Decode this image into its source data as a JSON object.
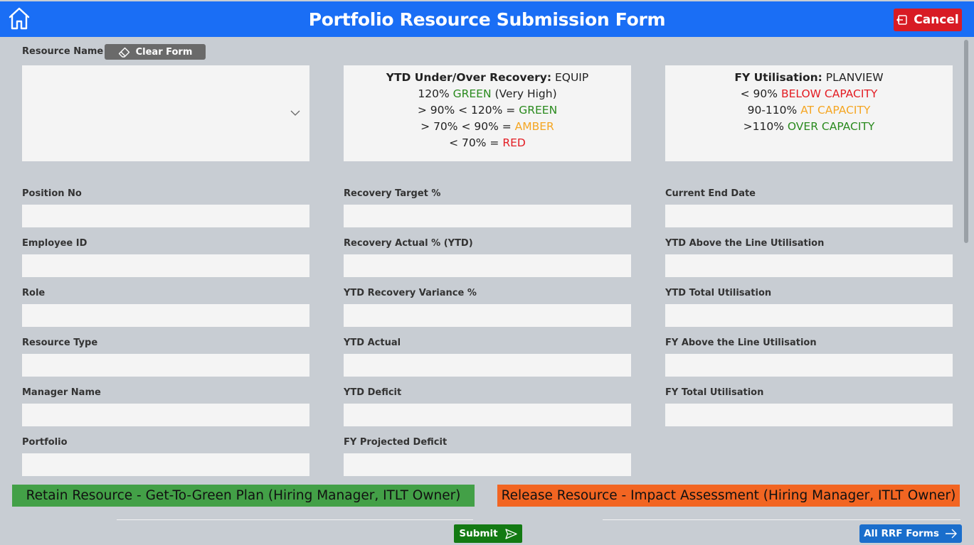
{
  "header": {
    "title": "Portfolio Resource Submission Form",
    "cancel_label": "Cancel"
  },
  "resource": {
    "label": "Resource Name",
    "clear_label": "Clear Form",
    "value": ""
  },
  "ytd_box": {
    "heading": "YTD Under/Over Recovery:",
    "source": "EQUIP",
    "rows": [
      {
        "pre": "120% ",
        "colored": "GREEN",
        "post": " (Very High)",
        "color": "#2a8a1e"
      },
      {
        "pre": "> 90% < 120% = ",
        "colored": "GREEN",
        "post": "",
        "color": "#2a8a1e"
      },
      {
        "pre": "> 70% < 90% = ",
        "colored": "AMBER",
        "post": "",
        "color": "#f5a623"
      },
      {
        "pre": "< 70% = ",
        "colored": "RED",
        "post": "",
        "color": "#e31c23"
      }
    ]
  },
  "fy_box": {
    "heading": "FY Utilisation:",
    "source": "PLANVIEW",
    "rows": [
      {
        "pre": "< 90% ",
        "colored": "BELOW CAPACITY",
        "color": "#e31c23"
      },
      {
        "pre": "90-110% ",
        "colored": "AT CAPACITY",
        "color": "#f5a623"
      },
      {
        "pre": ">110% ",
        "colored": "OVER CAPACITY",
        "color": "#2a8a1e"
      }
    ]
  },
  "fields": {
    "col1": [
      "Position No",
      "Employee ID",
      "Role",
      "Resource Type",
      "Manager Name",
      "Portfolio"
    ],
    "col2": [
      "Recovery Target %",
      "Recovery Actual % (YTD)",
      "YTD Recovery Variance %",
      "YTD Actual",
      "YTD Deficit",
      "FY Projected Deficit"
    ],
    "col3": [
      "Current End Date",
      "YTD Above the Line Utilisation",
      "YTD Total Utilisation",
      "FY Above the Line Utilisation",
      "FY Total Utilisation"
    ]
  },
  "banners": {
    "retain": "Retain Resource - Get-To-Green Plan (Hiring Manager, ITLT Owner)",
    "release": "Release Resource - Impact Assessment (Hiring Manager, ITLT Owner)"
  },
  "footer": {
    "submit_label": "Submit",
    "all_forms_label": "All RRF Forms"
  },
  "colors": {
    "header": "#1a6ef5",
    "cancel": "#d81b24",
    "retain_banner": "#43a047",
    "release_banner": "#f26522",
    "submit": "#137a13",
    "all_forms": "#1a6ecc"
  }
}
